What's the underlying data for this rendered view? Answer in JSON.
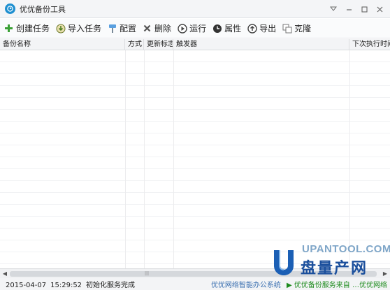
{
  "window": {
    "title": "优优备份工具"
  },
  "toolbar": {
    "buttons": [
      {
        "label": "创建任务",
        "icon": "plus-icon",
        "color": "#3aa035"
      },
      {
        "label": "导入任务",
        "icon": "import-icon",
        "color": "#5c8a2a"
      },
      {
        "label": "配置",
        "icon": "config-icon",
        "color": "#4a90d9"
      },
      {
        "label": "删除",
        "icon": "delete-icon",
        "color": "#555555"
      },
      {
        "label": "运行",
        "icon": "run-icon",
        "color": "#444444"
      },
      {
        "label": "属性",
        "icon": "clock-icon",
        "color": "#333333"
      },
      {
        "label": "导出",
        "icon": "export-icon",
        "color": "#444444"
      },
      {
        "label": "克隆",
        "icon": "clone-icon",
        "color": "#777777"
      }
    ]
  },
  "table": {
    "columns": [
      "备份名称",
      "方式",
      "更新标志",
      "触发器",
      "下次执行时间"
    ]
  },
  "status": {
    "date": "2015-04-07",
    "time": "15:29:52",
    "message": "初始化服务完成",
    "link": "优优网络智能办公系统",
    "promo": "▶ 优优备份服务来自 …优优网络"
  },
  "watermark": {
    "url": "UPANTOOL.COM",
    "name": "盘量产网"
  },
  "colors": {
    "accent": "#1e8fd0",
    "brand": "#1b4f9c"
  }
}
